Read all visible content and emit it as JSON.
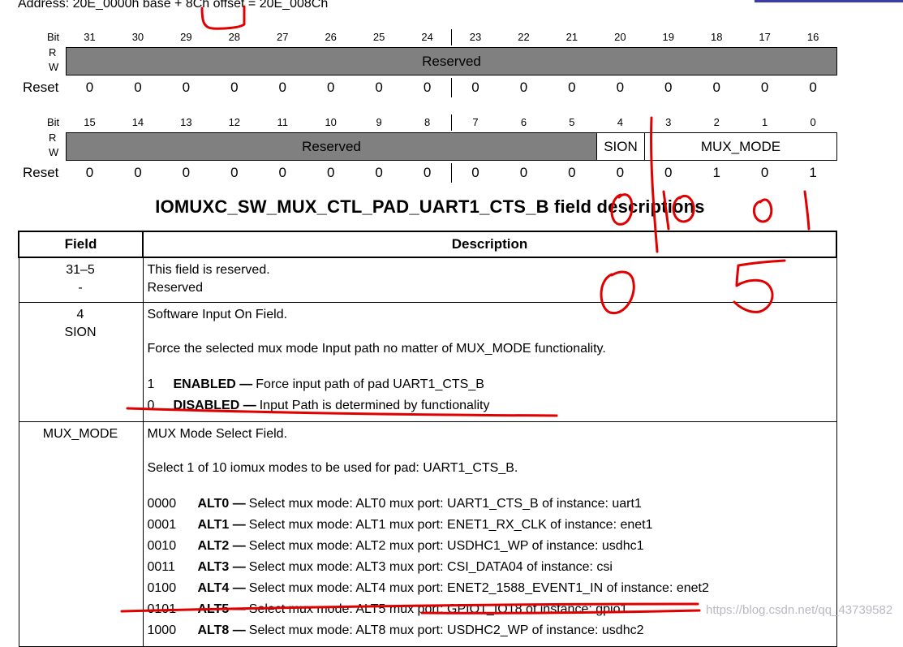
{
  "address": "Address: 20E_0000h base + 8Ch offset = 20E_008Ch",
  "reg_labels": {
    "bit": "Bit",
    "r": "R",
    "w": "W",
    "reset": "Reset"
  },
  "reg_upper": {
    "bits": [
      "31",
      "30",
      "29",
      "28",
      "27",
      "26",
      "25",
      "24",
      "23",
      "22",
      "21",
      "20",
      "19",
      "18",
      "17",
      "16"
    ],
    "field": "Reserved",
    "reset": [
      "0",
      "0",
      "0",
      "0",
      "0",
      "0",
      "0",
      "0",
      "0",
      "0",
      "0",
      "0",
      "0",
      "0",
      "0",
      "0"
    ]
  },
  "reg_lower": {
    "bits": [
      "15",
      "14",
      "13",
      "12",
      "11",
      "10",
      "9",
      "8",
      "7",
      "6",
      "5",
      "4",
      "3",
      "2",
      "1",
      "0"
    ],
    "fields": {
      "reserved": "Reserved",
      "sion": "SION",
      "mux_mode": "MUX_MODE"
    },
    "reset": [
      "0",
      "0",
      "0",
      "0",
      "0",
      "0",
      "0",
      "0",
      "0",
      "0",
      "0",
      "0",
      "0",
      "1",
      "0",
      "1"
    ]
  },
  "table": {
    "title": "IOMUXC_SW_MUX_CTL_PAD_UART1_CTS_B field descriptions",
    "headers": {
      "field": "Field",
      "description": "Description"
    },
    "row_reserved": {
      "field1": "31–5",
      "field2": "-",
      "line1": "This field is reserved.",
      "line2": "Reserved"
    },
    "row_sion": {
      "field1": "4",
      "field2": "SION",
      "line1": "Software Input On Field.",
      "line2": "Force the selected mux mode Input path no matter of MUX_MODE functionality.",
      "options": [
        {
          "code": "1",
          "name": "ENABLED —",
          "text": "Force input path of pad UART1_CTS_B"
        },
        {
          "code": "0",
          "name": "DISABLED —",
          "text": "Input Path is determined by functionality"
        }
      ]
    },
    "row_mux": {
      "field1": "MUX_MODE",
      "line1": "MUX Mode Select Field.",
      "line2": "Select 1 of 10 iomux modes to be used for pad: UART1_CTS_B.",
      "options": [
        {
          "code": "0000",
          "name": "ALT0 —",
          "text": "Select mux mode: ALT0 mux port: UART1_CTS_B of instance: uart1"
        },
        {
          "code": "0001",
          "name": "ALT1 —",
          "text": "Select mux mode: ALT1 mux port: ENET1_RX_CLK of instance: enet1"
        },
        {
          "code": "0010",
          "name": "ALT2 —",
          "text": "Select mux mode: ALT2 mux port: USDHC1_WP of instance: usdhc1"
        },
        {
          "code": "0011",
          "name": "ALT3 —",
          "text": "Select mux mode: ALT3 mux port: CSI_DATA04 of instance: csi"
        },
        {
          "code": "0100",
          "name": "ALT4 —",
          "text": "Select mux mode: ALT4 mux port: ENET2_1588_EVENT1_IN of instance: enet2"
        },
        {
          "code": "0101",
          "name": "ALT5 —",
          "text": "Select mux mode: ALT5 mux port: GPIO1_IO18 of instance: gpio1"
        },
        {
          "code": "1000",
          "name": "ALT8 —",
          "text": "Select mux mode: ALT8 mux port: USDHC2_WP of instance: usdhc2"
        }
      ]
    }
  },
  "watermark": "https://blog.csdn.net/qq_43739582",
  "colors": {
    "reserved_fill": "#808080",
    "annotation": "#e00000",
    "watermark": "#b9b9c4"
  },
  "handwritten_annotations": [
    "0",
    "1",
    "0",
    "1",
    "0",
    "5"
  ]
}
